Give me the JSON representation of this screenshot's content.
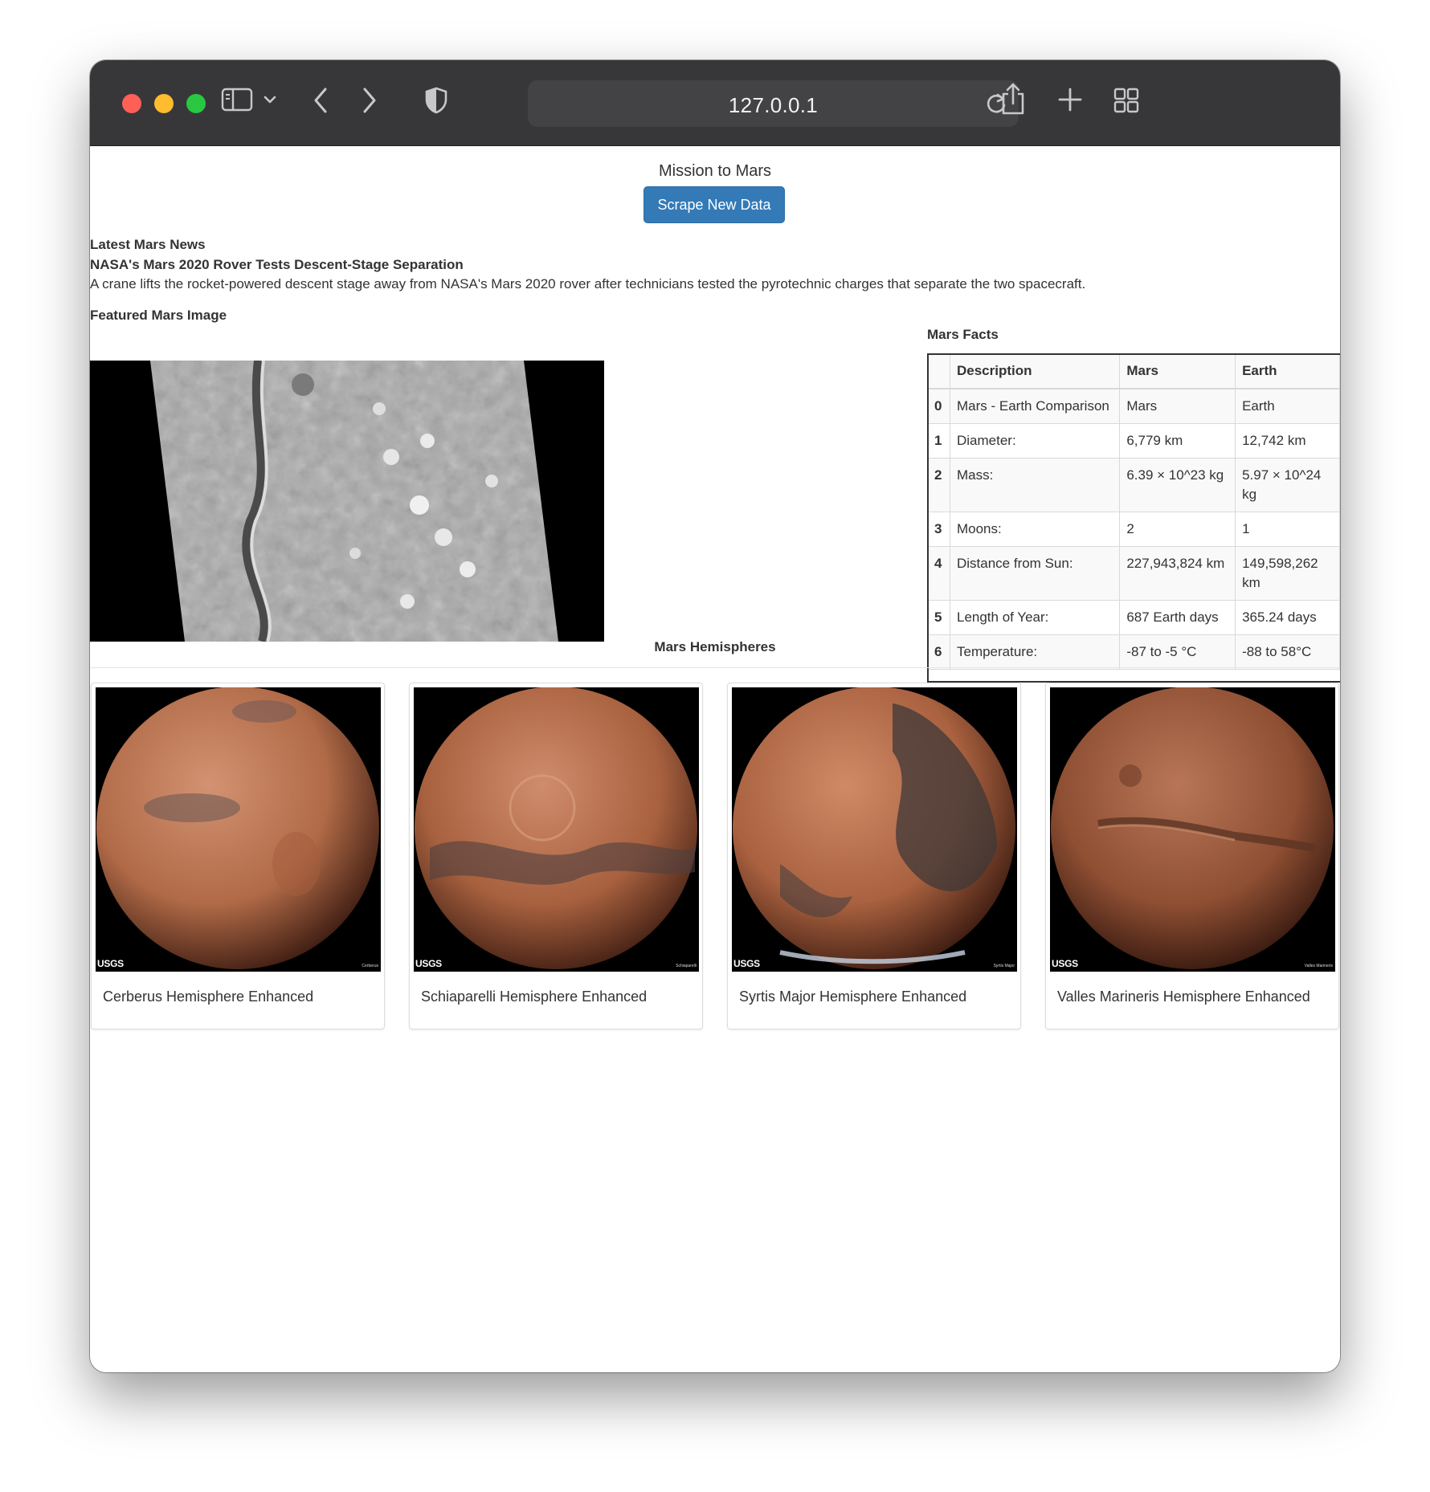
{
  "browser": {
    "url": "127.0.0.1"
  },
  "page": {
    "title": "Mission to Mars",
    "scrape_button": "Scrape New Data"
  },
  "news": {
    "section_label": "Latest Mars News",
    "title": "NASA's Mars 2020 Rover Tests Descent-Stage Separation",
    "paragraph": "A crane lifts the rocket-powered descent stage away from NASA's Mars 2020 rover after technicians tested the pyrotechnic charges that separate the two spacecraft."
  },
  "featured": {
    "section_label": "Featured Mars Image"
  },
  "facts": {
    "section_label": "Mars Facts",
    "headers": [
      "",
      "Description",
      "Mars",
      "Earth"
    ],
    "rows": [
      {
        "index": "0",
        "description": "Mars - Earth Comparison",
        "mars": "Mars",
        "earth": "Earth"
      },
      {
        "index": "1",
        "description": "Diameter:",
        "mars": "6,779 km",
        "earth": "12,742 km"
      },
      {
        "index": "2",
        "description": "Mass:",
        "mars": "6.39 × 10^23 kg",
        "earth": "5.97 × 10^24 kg"
      },
      {
        "index": "3",
        "description": "Moons:",
        "mars": "2",
        "earth": "1"
      },
      {
        "index": "4",
        "description": "Distance from Sun:",
        "mars": "227,943,824 km",
        "earth": "149,598,262 km"
      },
      {
        "index": "5",
        "description": "Length of Year:",
        "mars": "687 Earth days",
        "earth": "365.24 days"
      },
      {
        "index": "6",
        "description": "Temperature:",
        "mars": "-87 to -5 °C",
        "earth": "-88 to 58°C"
      }
    ]
  },
  "hemispheres": {
    "section_label": "Mars Hemispheres",
    "items": [
      {
        "title": "Cerberus Hemisphere Enhanced",
        "logo": "USGS",
        "corner": "Cerberus"
      },
      {
        "title": "Schiaparelli Hemisphere Enhanced",
        "logo": "USGS",
        "corner": "Schiaparelli"
      },
      {
        "title": "Syrtis Major Hemisphere Enhanced",
        "logo": "USGS",
        "corner": "Syrtis Major"
      },
      {
        "title": "Valles Marineris Hemisphere Enhanced",
        "logo": "USGS",
        "corner": "Valles Marineris"
      }
    ]
  },
  "colors": {
    "button_primary": "#337ab7",
    "titlebar": "#37373a",
    "mars_surface": "#b86a46"
  },
  "icons": [
    "sidebar-icon",
    "chevron-down-icon",
    "back-icon",
    "forward-icon",
    "shield-icon",
    "reload-icon",
    "share-icon",
    "new-tab-icon",
    "tab-overview-icon"
  ]
}
